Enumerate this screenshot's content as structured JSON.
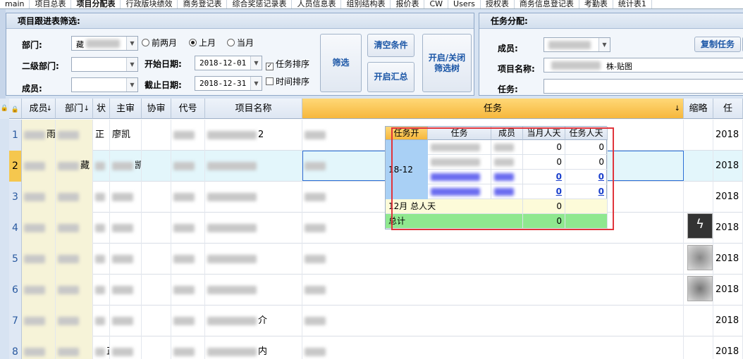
{
  "tabs": [
    "main",
    "项目总表",
    "项目分配表",
    "行政版块绩效",
    "商务登记表",
    "综合奖惩记录表",
    "人员信息表",
    "组别结构表",
    "报价表",
    "CW",
    "Users",
    "授权表",
    "商务信息登记表",
    "考勤表",
    "统计表1"
  ],
  "active_tab": "项目分配表",
  "filter": {
    "title": "项目跟进表筛选:",
    "dept_label": "部门:",
    "dept_value": "藏",
    "sub_dept_label": "二级部门:",
    "member_label": "成员:",
    "radios": [
      "前两月",
      "上月",
      "当月"
    ],
    "radio_selected": "上月",
    "start_label": "开始日期:",
    "start_value": "2018-12-01",
    "end_label": "截止日期:",
    "end_value": "2018-12-31",
    "chk_task_sort": "任务排序",
    "chk_time_sort": "时间排序",
    "btn_filter": "筛选",
    "btn_clear": "清空条件",
    "btn_summary": "开启汇总",
    "btn_tree_l1": "开启/关闭",
    "btn_tree_l2": "筛选树"
  },
  "assign": {
    "title": "任务分配:",
    "member_label": "成员:",
    "btn_copy": "复制任务",
    "project_label": "项目名称:",
    "project_value": "株-贴图",
    "task_label": "任务:"
  },
  "grid": {
    "headers": [
      "成员",
      "部门",
      "状",
      "主审",
      "协审",
      "代号",
      "项目名称",
      "任务",
      "缩略",
      "任"
    ],
    "row_numbers": [
      "1",
      "2",
      "3",
      "4",
      "5",
      "6",
      "7",
      "8"
    ],
    "rows": [
      {
        "member": "雨",
        "dept": "",
        "status": "正",
        "reviewer": "廖凯",
        "code": "",
        "name": "2",
        "task": "",
        "year": "2018"
      },
      {
        "member": "",
        "dept": "藏",
        "status": "",
        "reviewer": "凯",
        "code": "",
        "name": "",
        "task": "",
        "year": "2018"
      },
      {
        "member": "",
        "dept": "",
        "status": "",
        "reviewer": "",
        "code": "",
        "name": "",
        "task": "",
        "year": "2018"
      },
      {
        "member": "",
        "dept": "",
        "status": "",
        "reviewer": "",
        "code": "",
        "name": "",
        "task": "",
        "year": "2018"
      },
      {
        "member": "",
        "dept": "",
        "status": "",
        "reviewer": "",
        "code": "",
        "name": "",
        "task": "",
        "year": "2018"
      },
      {
        "member": "",
        "dept": "",
        "status": "",
        "reviewer": "",
        "code": "",
        "name": "",
        "task": "",
        "year": "2018"
      },
      {
        "member": "",
        "dept": "",
        "status": "",
        "reviewer": "",
        "code": "",
        "name": "介",
        "task": "",
        "year": "2018"
      },
      {
        "member": "",
        "dept": "",
        "status": "正凯",
        "reviewer": "",
        "code": "",
        "name": "内",
        "task": "",
        "year": "2018"
      }
    ]
  },
  "popup": {
    "headers": [
      "任务开",
      "任务",
      "成员",
      "当月人天",
      "任务人天"
    ],
    "date_range": "18-12",
    "rows": [
      [
        "",
        "",
        "",
        "0",
        "0"
      ],
      [
        "",
        "",
        "",
        "0",
        "0"
      ],
      [
        "",
        "",
        "",
        "0",
        "0"
      ],
      [
        "",
        "",
        "",
        "0",
        "0"
      ]
    ],
    "month_total_label": "12月 总人天",
    "month_total_value": "0",
    "total_label": "总计",
    "total_value": "0"
  }
}
